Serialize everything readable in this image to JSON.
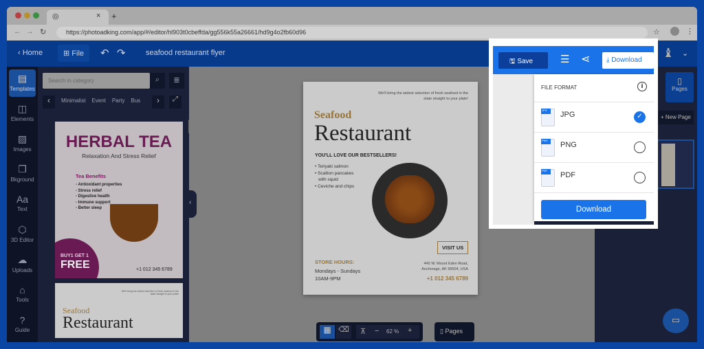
{
  "browser": {
    "url": "https://photoadking.com/app/#/editor/hl903t0cbeffda/gg556k55a26661/hd9g4o2fb60d96",
    "tab_close": "×",
    "new_tab": "+"
  },
  "header": {
    "home": "Home",
    "file": "File",
    "title": "seafood restaurant flyer",
    "save": "Save",
    "download": "Download"
  },
  "rail": [
    {
      "label": "Templates",
      "icon": "▤"
    },
    {
      "label": "Elements",
      "icon": "◫"
    },
    {
      "label": "Images",
      "icon": "▨"
    },
    {
      "label": "Bkground",
      "icon": "❐"
    },
    {
      "label": "Text",
      "icon": "Aa"
    },
    {
      "label": "3D Editor",
      "icon": "⬡"
    },
    {
      "label": "Uploads",
      "icon": "☁"
    },
    {
      "label": "Tools",
      "icon": "⌂"
    },
    {
      "label": "Guide",
      "icon": "?"
    }
  ],
  "panel": {
    "search_placeholder": "Search in category",
    "categories": [
      "Minimalist",
      "Event",
      "Party",
      "Bus"
    ],
    "t1": {
      "title": "HERBAL TEA",
      "subtitle": "Relaxation And Stress Relief",
      "benefits_title": "Tea Benefits",
      "benefits": [
        "- Antioxidant properties",
        "- Stress relief",
        "- Digestive health",
        "- Immune support",
        "- Better sleep"
      ],
      "promo1": "BUY1 GET 1",
      "promo2": "FREE",
      "phone": "+1 012 345 6789"
    },
    "t2": {
      "tagline": "We'll bring the widest selection of fresh seafood in the state straight to your plate!",
      "title1": "Seafood",
      "title2": "Restaurant"
    }
  },
  "flyer": {
    "tagline": "We'll bring the widest selection of fresh seafood in the state straight to your plate!",
    "title1": "Seafood",
    "title2": "Restaurant",
    "headline": "YOU'LL LOVE OUR BESTSELLERS!",
    "items": [
      "• Teriyaki salmon",
      "• Scallion pancakes",
      "with squid",
      "• Ceviche and chips"
    ],
    "visit": "VISIT US",
    "hours_label": "STORE HOURS:",
    "days": "Mondays - Sundays",
    "hours": "10AM-9PM",
    "address1": "445 W. Mount Eden Road,",
    "address2": "Anchorage, AK 99504, USA",
    "phone": "+1 012 345 6789"
  },
  "toolbar": {
    "zoom": "62 %",
    "minus": "−",
    "plus": "+",
    "pages": "Pages"
  },
  "right": {
    "pages": "Pages",
    "new_page": "+ New Page"
  },
  "download_menu": {
    "title": "FILE FORMAT",
    "formats": [
      {
        "label": "JPG",
        "tag": "JPG",
        "selected": true
      },
      {
        "label": "PNG",
        "tag": "PNG",
        "selected": false
      },
      {
        "label": "PDF",
        "tag": "PDF",
        "selected": false
      }
    ],
    "button": "Download"
  },
  "colors": {
    "accent": "#1a73e8",
    "brand_blue": "#0a45a3",
    "gold": "#c8902e",
    "purple": "#7a1a5e"
  }
}
